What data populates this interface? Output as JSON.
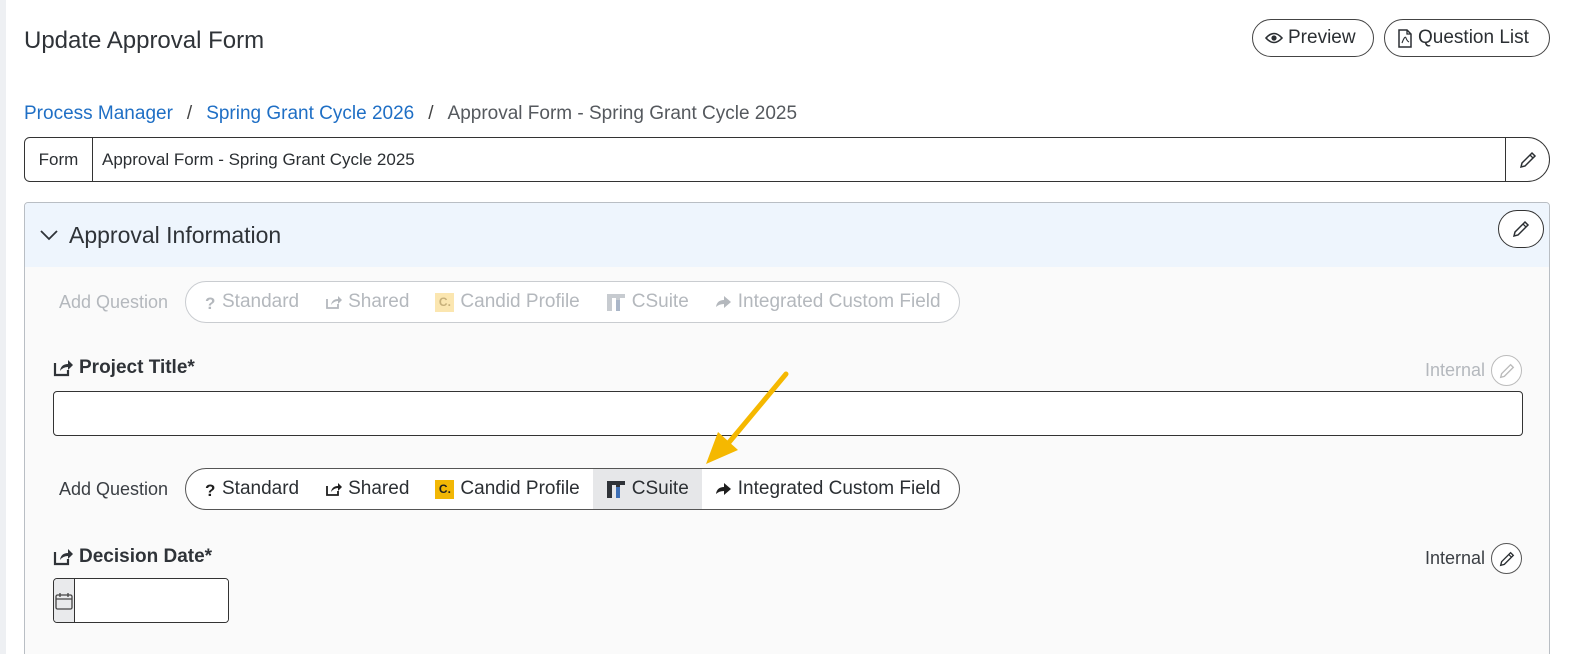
{
  "page": {
    "title": "Update Approval Form"
  },
  "toolbar": {
    "preview_label": "Preview",
    "question_list_label": "Question List"
  },
  "breadcrumb": {
    "items": [
      "Process Manager",
      "Spring Grant Cycle 2026",
      "Approval Form - Spring Grant Cycle 2025"
    ],
    "separator": "/"
  },
  "form": {
    "label": "Form",
    "value": "Approval Form - Spring Grant Cycle 2025"
  },
  "section": {
    "title": "Approval Information",
    "add_question_label": "Add Question",
    "question_types": [
      "Standard",
      "Shared",
      "Candid Profile",
      "CSuite",
      "Integrated Custom Field"
    ],
    "candid_badge": "C.",
    "questions": [
      {
        "label": "Project Title*",
        "visibility": "Internal",
        "value": ""
      },
      {
        "label": "Decision Date*",
        "visibility": "Internal",
        "value": ""
      }
    ]
  },
  "colors": {
    "link": "#1f6fc5",
    "header_bg": "#eef5fd",
    "arrow": "#f5b800",
    "candid": "#f2b705"
  }
}
